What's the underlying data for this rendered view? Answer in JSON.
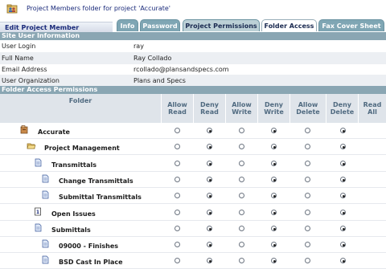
{
  "window": {
    "title": "Project Members folder for project 'Accurate'",
    "icon": "folder-users-icon"
  },
  "section_label": "Edit Project Member",
  "tabs": [
    {
      "label": "Info",
      "state": "inactive"
    },
    {
      "label": "Password",
      "state": "inactive"
    },
    {
      "label": "Project Permissions",
      "state": "inactive"
    },
    {
      "label": "Folder Access",
      "state": "active"
    },
    {
      "label": "Fax Cover Sheet",
      "state": "inactive"
    }
  ],
  "site_user": {
    "header": "Site User Information",
    "rows": [
      {
        "label": "User Login",
        "value": "ray"
      },
      {
        "label": "Full Name",
        "value": "Ray Collado"
      },
      {
        "label": "Email Address",
        "value": "rcollado@plansandspecs.com"
      },
      {
        "label": "User Organization",
        "value": "Plans and Specs"
      }
    ]
  },
  "permissions": {
    "header": "Folder Access Permissions",
    "columns": [
      "Folder",
      "Allow Read",
      "Deny Read",
      "Allow Write",
      "Deny Write",
      "Allow Delete",
      "Deny Delete",
      "Read All"
    ],
    "rows": [
      {
        "name": "Accurate",
        "icon": "project-cabinet-icon",
        "level": 0,
        "read": "deny",
        "write": "deny",
        "delete": "deny"
      },
      {
        "name": "Project Management",
        "icon": "open-folder-icon",
        "level": 1,
        "read": "deny",
        "write": "deny",
        "delete": "deny"
      },
      {
        "name": "Transmittals",
        "icon": "document-icon",
        "level": 2,
        "read": "deny",
        "write": "deny",
        "delete": "deny"
      },
      {
        "name": "Change Transmittals",
        "icon": "document-icon",
        "level": 3,
        "read": "deny",
        "write": "deny",
        "delete": "deny"
      },
      {
        "name": "Submittal Transmittals",
        "icon": "document-icon",
        "level": 3,
        "read": "deny",
        "write": "deny",
        "delete": "deny"
      },
      {
        "name": "Open Issues",
        "icon": "issue-document-icon",
        "level": 2,
        "read": "deny",
        "write": "deny",
        "delete": "deny"
      },
      {
        "name": "Submittals",
        "icon": "document-icon",
        "level": 2,
        "read": "deny",
        "write": "deny",
        "delete": "deny"
      },
      {
        "name": "09000 - Finishes",
        "icon": "document-icon",
        "level": 3,
        "read": "deny",
        "write": "deny",
        "delete": "deny"
      },
      {
        "name": "BSD Cast In Place",
        "icon": "document-icon",
        "level": 3,
        "read": "deny",
        "write": "deny",
        "delete": "deny"
      }
    ]
  },
  "colors": {
    "header_bar": "#8aa6b3",
    "tab_inactive": "#7fa6b4",
    "title_text": "#1a2a7a",
    "column_header_text": "#506a80"
  }
}
